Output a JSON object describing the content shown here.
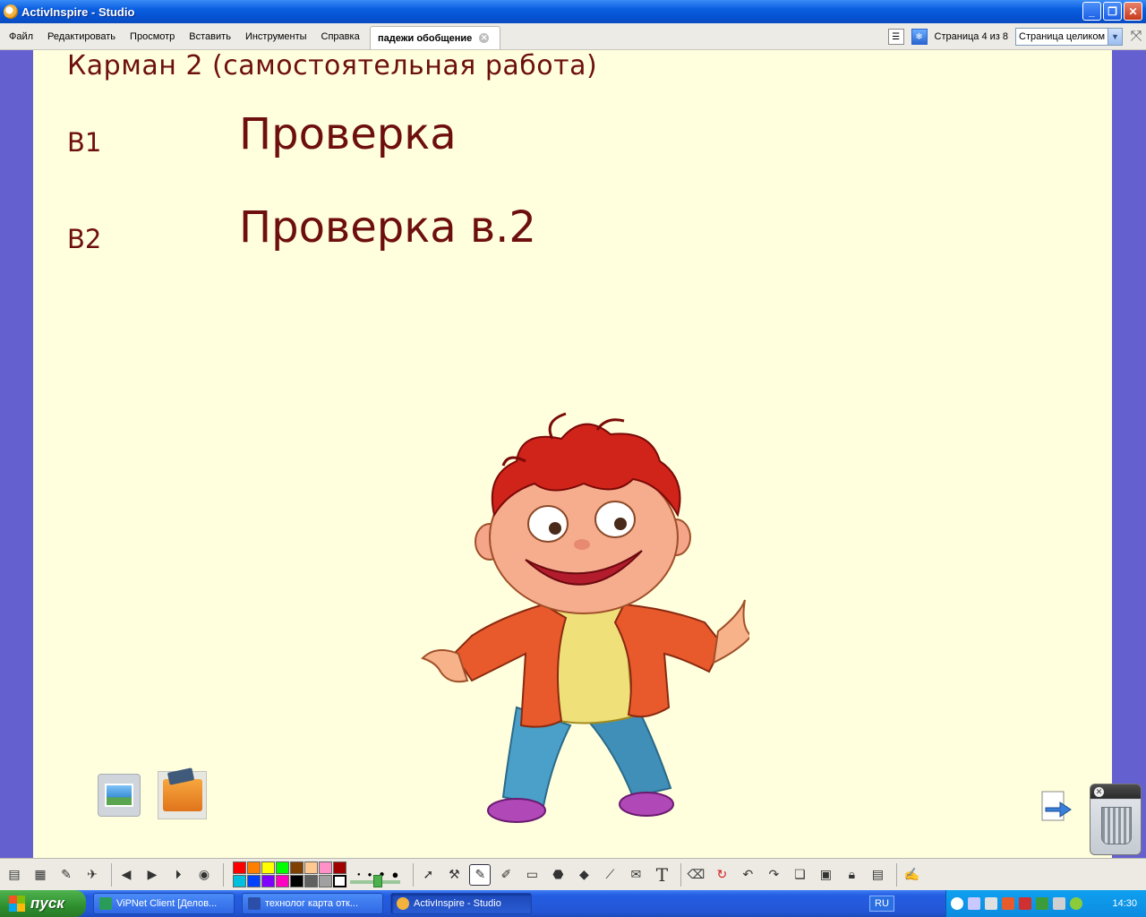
{
  "window": {
    "title": "ActivInspire - Studio"
  },
  "menu": {
    "items": [
      "Файл",
      "Редактировать",
      "Просмотр",
      "Вставить",
      "Инструменты",
      "Справка"
    ],
    "doc_tab": "падежи обобщение",
    "page_indicator": "Страница 4 из 8",
    "zoom": "Страница целиком"
  },
  "slide": {
    "title": "Карман 2 (самостоятельная работа)",
    "label_b1": "В1",
    "check_b1": "Проверка",
    "label_b2": "В2",
    "check_b2": "Проверка в.2",
    "text_color": "#6e0f0f",
    "background": "#ffffdd"
  },
  "toolbar": {
    "palette": [
      "#ff0000",
      "#ff8000",
      "#ffff00",
      "#00ff00",
      "#804000",
      "#ffc890",
      "#ff90c8",
      "#a00000",
      "#00c0e0",
      "#0040ff",
      "#8000ff",
      "#ff00c0",
      "#000000",
      "#606060",
      "#a0a0a0",
      "#ffffff"
    ]
  },
  "taskbar": {
    "start_label": "пуск",
    "tasks": [
      "ViPNet Client [Делов...",
      "технолог карта отк...",
      "ActivInspire - Studio"
    ],
    "lang": "RU",
    "clock": "14:30"
  }
}
